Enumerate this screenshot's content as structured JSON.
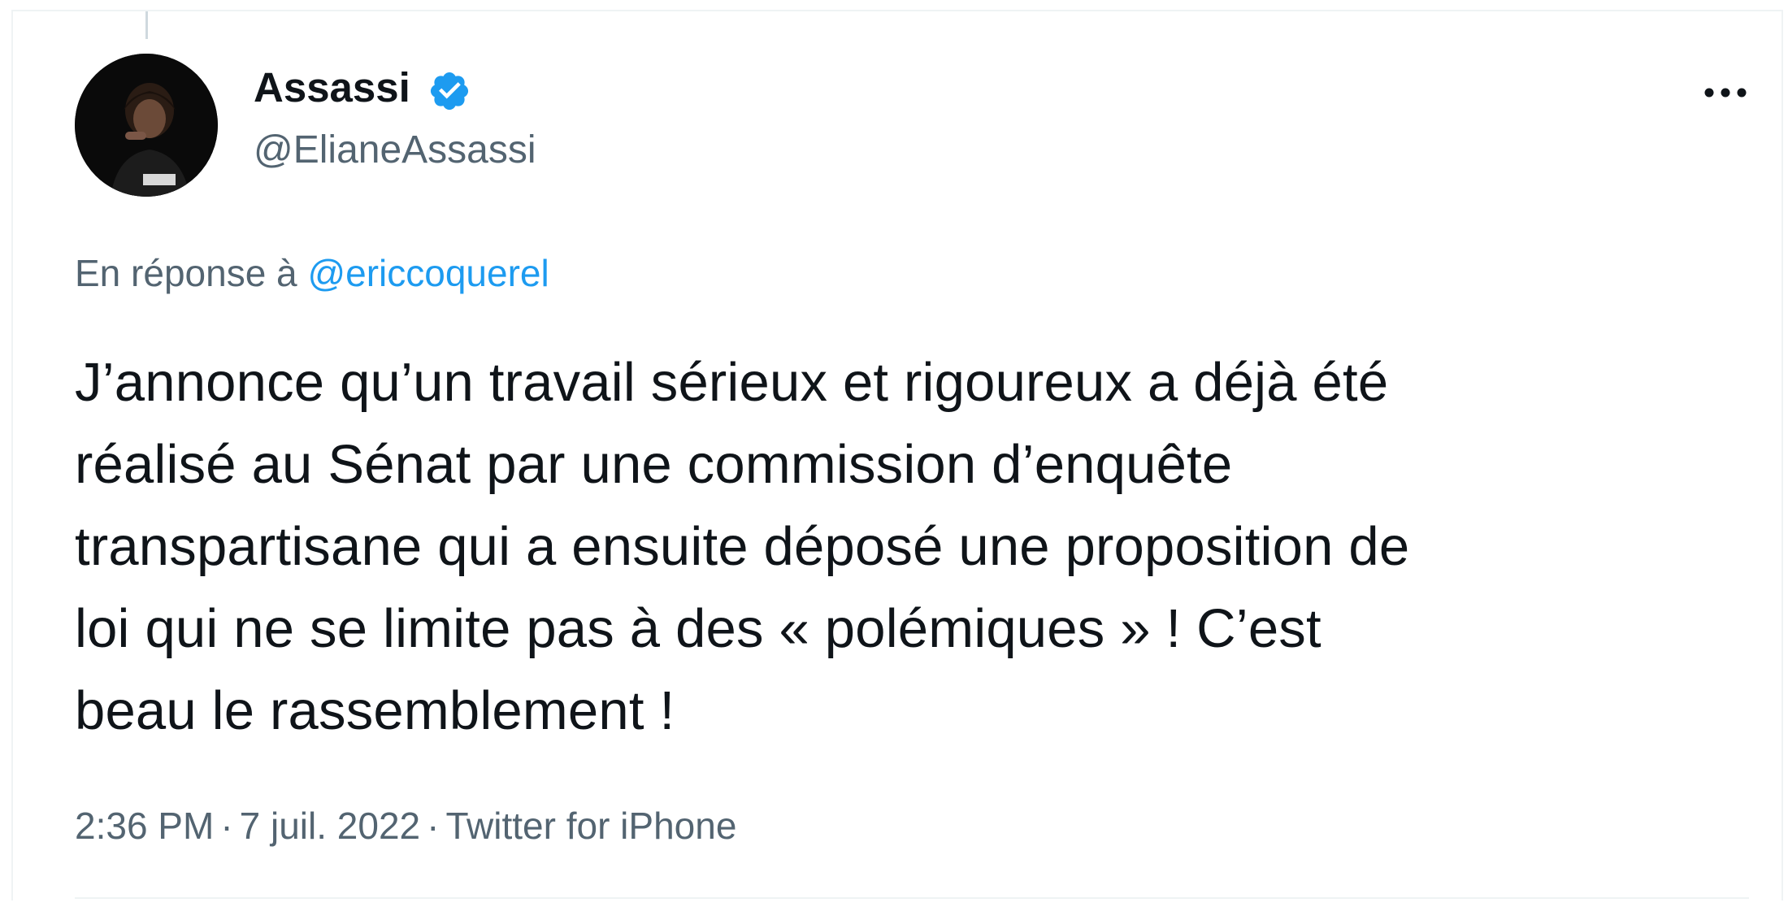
{
  "tweet": {
    "author_name": "Assassi",
    "author_handle": "@ElianeAssassi",
    "verified": true,
    "reply_prefix": "En réponse à",
    "reply_to": "@ericcoquerel",
    "text_lines": [
      "J’annonce qu’un travail sérieux et rigoureux a déjà été",
      "réalisé au Sénat par une commission d’enquête",
      "transpartisane qui a ensuite déposé une proposition de",
      "loi qui ne se limite pas à des « polémiques » ! C’est",
      "beau le rassemblement !"
    ],
    "time": "2:36 PM",
    "separator": "·",
    "date": "7 juil. 2022",
    "source": "Twitter for iPhone"
  },
  "icons": {
    "verified": "verified-badge-icon",
    "more": "more-options-icon"
  },
  "colors": {
    "text_primary": "#0f1419",
    "text_secondary": "#536471",
    "accent": "#1d9bf0",
    "border": "#eff3f4"
  }
}
